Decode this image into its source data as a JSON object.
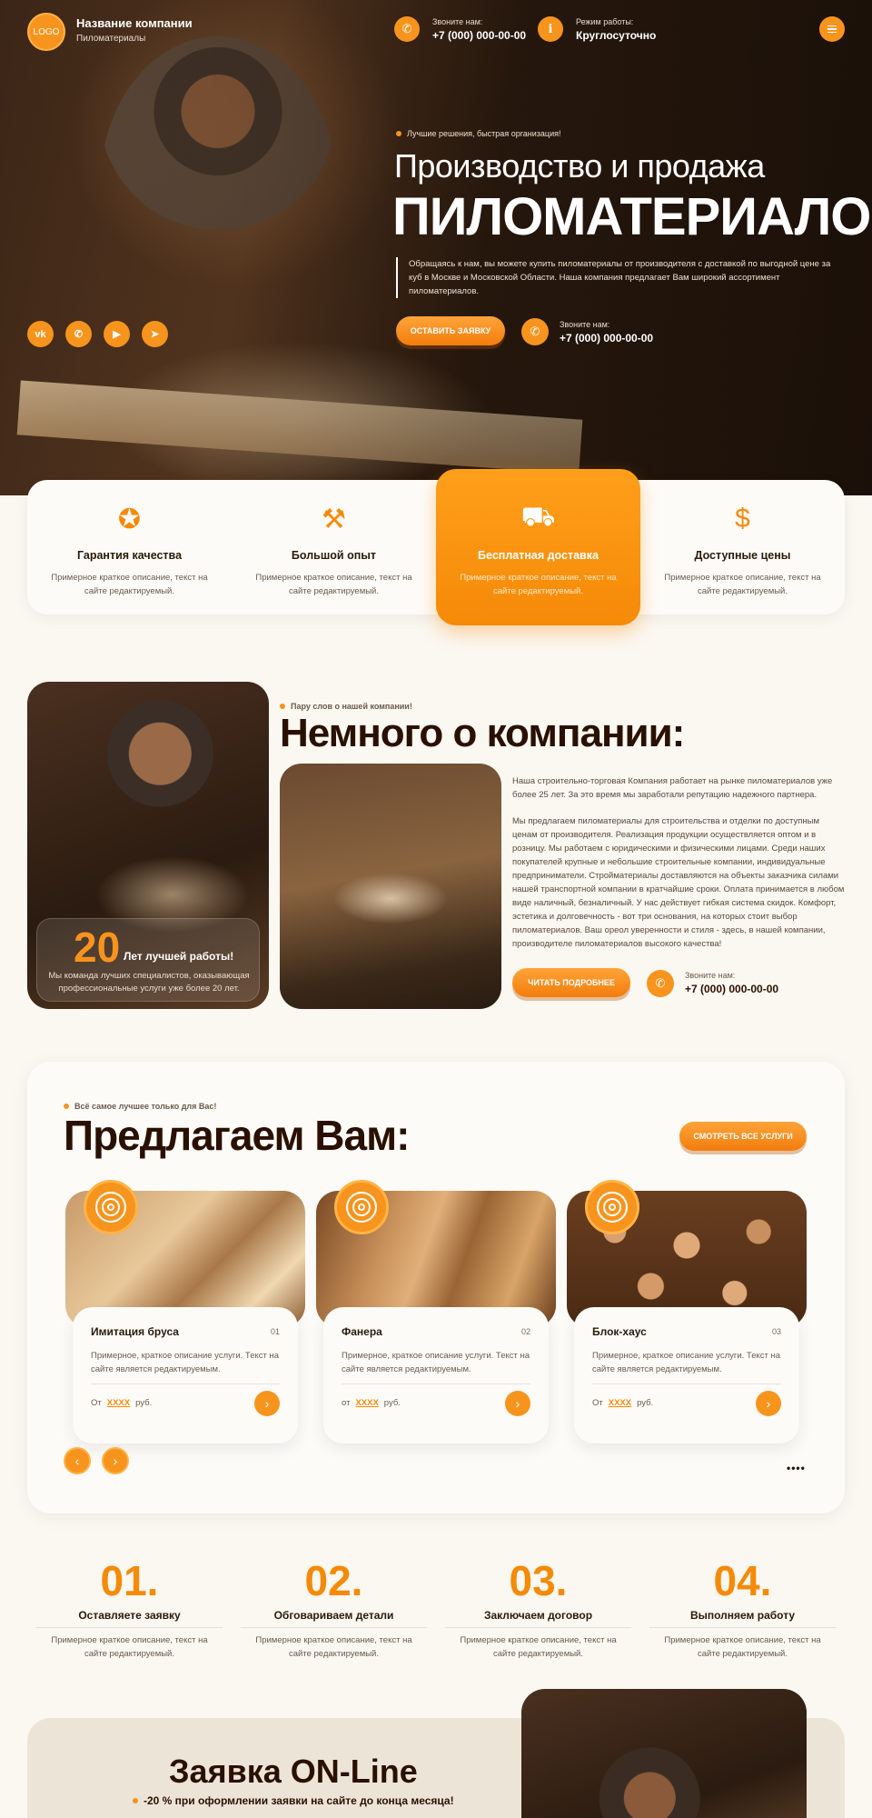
{
  "header": {
    "logo": "LOGO",
    "company_name": "Название компании",
    "company_sub": "Пиломатериалы",
    "call_label": "Звоните нам:",
    "call_phone": "+7 (000) 000-00-00",
    "hours_label": "Режим работы:",
    "hours_value": "Круглосуточно"
  },
  "hero": {
    "tagline": "Лучшие решения, быстрая организация!",
    "title_line1": "Производство и продажа",
    "title_line2": "ПИЛОМАТЕРИАЛОВ",
    "description": "Обращаясь к нам, вы можете купить пиломатериалы от производителя с доставкой по выгодной цене за куб в Москве и Московской Области. Наша компания предлагает Вам широкий ассортимент пиломатериалов.",
    "cta": "ОСТАВИТЬ ЗАЯВКУ",
    "call_label": "Звоните нам:",
    "call_phone": "+7 (000) 000-00-00",
    "socials": [
      "vk",
      "wa",
      "yt",
      "tg"
    ]
  },
  "features": [
    {
      "icon": "quality-icon",
      "title": "Гарантия качества",
      "desc": "Примерное краткое описание, текст на сайте редактируемый."
    },
    {
      "icon": "experience-icon",
      "title": "Большой опыт",
      "desc": "Примерное краткое описание, текст на сайте редактируемый."
    },
    {
      "icon": "delivery-icon",
      "title": "Бесплатная доставка",
      "desc": "Примерное краткое описание, текст на сайте редактируемый."
    },
    {
      "icon": "price-icon",
      "title": "Доступные цены",
      "desc": "Примерное краткое описание, текст на сайте редактируемый."
    }
  ],
  "about": {
    "tag": "Пару слов о нашей компании!",
    "title": "Немного о компании:",
    "stat_number": "20",
    "stat_label": "Лет лучшей работы!",
    "stat_desc": "Мы команда лучших специалистов, оказывающая профессиональные услуги уже более 20 лет.",
    "para1": "Наша строительно-торговая Компания работает на рынке пиломатериалов уже более 25 лет. За это время мы заработали репутацию надежного партнера.",
    "para2": "Мы предлагаем пиломатериалы для строительства и отделки по доступным ценам от производителя. Реализация продукции осуществляется оптом и в розницу. Мы работаем с юридическими и физическими лицами. Среди наших покупателей крупные и небольшие строительные компании, индивидуальные предприниматели. Стройматериалы доставляются на объекты заказчика силами нашей транспортной компании в кратчайшие сроки. Оплата принимается в любом виде наличный, безналичный. У нас действует гибкая система скидок. Комфорт, эстетика и долговечность - вот три основания, на которых стоит выбор пиломатериалов. Ваш ореол уверенности и стиля - здесь, в нашей компании, производителе пиломатериалов высокого качества!",
    "cta": "ЧИТАТЬ ПОДРОБНЕЕ",
    "call_label": "Звоните нам:",
    "call_phone": "+7 (000) 000-00-00"
  },
  "services": {
    "tag": "Всё самое лучшее только для Вас!",
    "title": "Предлагаем Вам:",
    "all_button": "СМОТРЕТЬ ВСЕ УСЛУГИ",
    "items": [
      {
        "name": "Имитация бруса",
        "no": "01",
        "desc": "Примерное, краткое описание услуги. Текст на сайте является редактируемым.",
        "price_from": "От",
        "price": "XXXX",
        "currency": "руб."
      },
      {
        "name": "Фанера",
        "no": "02",
        "desc": "Примерное, краткое описание услуги. Текст на сайте является редактируемым.",
        "price_from": "от",
        "price": "XXXX",
        "currency": "руб."
      },
      {
        "name": "Блок-хаус",
        "no": "03",
        "desc": "Примерное, краткое описание услуги. Текст на сайте является редактируемым.",
        "price_from": "От",
        "price": "XXXX",
        "currency": "руб."
      }
    ],
    "more": "••••"
  },
  "steps": [
    {
      "num": "01.",
      "title": "Оставляете заявку",
      "desc": "Примерное краткое описание, текст на сайте редактируемый."
    },
    {
      "num": "02.",
      "title": "Обговариваем детали",
      "desc": "Примерное краткое описание, текст на сайте редактируемый."
    },
    {
      "num": "03.",
      "title": "Заключаем договор",
      "desc": "Примерное краткое описание, текст на сайте редактируемый."
    },
    {
      "num": "04.",
      "title": "Выполняем работу",
      "desc": "Примерное краткое описание, текст на сайте редактируемый."
    }
  ],
  "order": {
    "title": "Заявка ON-Line",
    "subtitle": "-20 % при оформлении заявки на сайте до конца месяца!"
  },
  "colors": {
    "accent": "#f7941d",
    "dark_text": "#2a1000",
    "background": "#fbf7f1"
  }
}
